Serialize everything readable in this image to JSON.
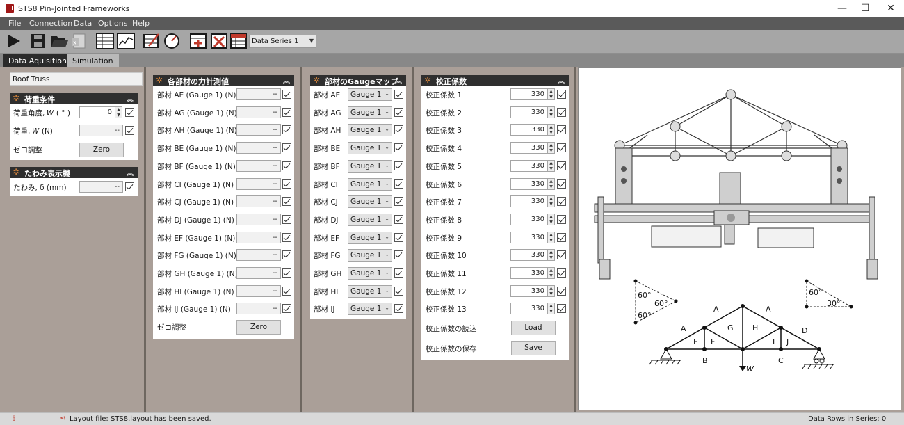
{
  "window": {
    "title": "STS8 Pin-Jointed Frameworks",
    "controls": [
      "—",
      "☐",
      "✕"
    ]
  },
  "menu": [
    "File",
    "Connection",
    "Data",
    "Options",
    "Help"
  ],
  "toolbar": {
    "series_selected": "Data Series 1"
  },
  "tabs": [
    "Data Aquisition",
    "Simulation"
  ],
  "col1": {
    "structure_name": "Roof Truss",
    "load_panel": {
      "title": "荷重条件",
      "angle_label": "荷重角度, 𝑊 ( ° )",
      "angle_value": "0",
      "load_label": "荷重, 𝑊 (N)",
      "load_value": "--",
      "zero_label": "ゼロ調整",
      "zero_button": "Zero"
    },
    "deflection_panel": {
      "title": "たわみ表示機",
      "label": "たわみ, δ (mm)",
      "value": "--"
    }
  },
  "forces": {
    "title": "各部材の力計測値",
    "rows": [
      {
        "label": "部材 AE (Gauge 1)  (N)",
        "value": "--"
      },
      {
        "label": "部材 AG (Gauge 1)  (N)",
        "value": "--"
      },
      {
        "label": "部材 AH (Gauge 1)  (N)",
        "value": "--"
      },
      {
        "label": "部材 BE (Gauge 1)  (N)",
        "value": "--"
      },
      {
        "label": "部材 BF (Gauge 1)  (N)",
        "value": "--"
      },
      {
        "label": "部材 CI (Gauge 1)  (N)",
        "value": "--"
      },
      {
        "label": "部材 CJ (Gauge 1)  (N)",
        "value": "--"
      },
      {
        "label": "部材 DJ (Gauge 1)  (N)",
        "value": "--"
      },
      {
        "label": "部材 EF (Gauge 1)  (N)",
        "value": "--"
      },
      {
        "label": "部材 FG (Gauge 1)  (N)",
        "value": "--"
      },
      {
        "label": "部材 GH (Gauge 1)  (N)",
        "value": "--"
      },
      {
        "label": "部材 HI (Gauge 1)  (N)",
        "value": "--"
      },
      {
        "label": "部材 IJ (Gauge 1)  (N)",
        "value": "--"
      }
    ],
    "zero_label": "ゼロ調整",
    "zero_button": "Zero"
  },
  "gaugemap": {
    "title": "部材のGaugeマップ",
    "rows": [
      {
        "member": "部材 AE",
        "gauge": "Gauge 1"
      },
      {
        "member": "部材 AG",
        "gauge": "Gauge 1"
      },
      {
        "member": "部材 AH",
        "gauge": "Gauge 1"
      },
      {
        "member": "部材 BE",
        "gauge": "Gauge 1"
      },
      {
        "member": "部材 BF",
        "gauge": "Gauge 1"
      },
      {
        "member": "部材 CI",
        "gauge": "Gauge 1"
      },
      {
        "member": "部材 CJ",
        "gauge": "Gauge 1"
      },
      {
        "member": "部材 DJ",
        "gauge": "Gauge 1"
      },
      {
        "member": "部材 EF",
        "gauge": "Gauge 1"
      },
      {
        "member": "部材 FG",
        "gauge": "Gauge 1"
      },
      {
        "member": "部材 GH",
        "gauge": "Gauge 1"
      },
      {
        "member": "部材 HI",
        "gauge": "Gauge 1"
      },
      {
        "member": "部材 IJ",
        "gauge": "Gauge 1"
      }
    ]
  },
  "calib": {
    "title": "校正係数",
    "rows": [
      {
        "label": "校正係数 1",
        "value": "330"
      },
      {
        "label": "校正係数 2",
        "value": "330"
      },
      {
        "label": "校正係数 3",
        "value": "330"
      },
      {
        "label": "校正係数 4",
        "value": "330"
      },
      {
        "label": "校正係数 5",
        "value": "330"
      },
      {
        "label": "校正係数 6",
        "value": "330"
      },
      {
        "label": "校正係数 7",
        "value": "330"
      },
      {
        "label": "校正係数 8",
        "value": "330"
      },
      {
        "label": "校正係数 9",
        "value": "330"
      },
      {
        "label": "校正係数 10",
        "value": "330"
      },
      {
        "label": "校正係数 11",
        "value": "330"
      },
      {
        "label": "校正係数 12",
        "value": "330"
      },
      {
        "label": "校正係数 13",
        "value": "330"
      }
    ],
    "load_label": "校正係数の読込",
    "load_button": "Load",
    "save_label": "校正係数の保存",
    "save_button": "Save"
  },
  "diagram": {
    "letters": [
      "A",
      "A",
      "A",
      "D",
      "E",
      "F",
      "G",
      "H",
      "I",
      "J",
      "B",
      "C"
    ],
    "load_symbol": "W",
    "angles": [
      "60°",
      "60°",
      "60°",
      "60°",
      "30°"
    ]
  },
  "status": {
    "message": "Layout file: STS8.layout has been saved.",
    "rows": "Data Rows in Series: 0"
  }
}
